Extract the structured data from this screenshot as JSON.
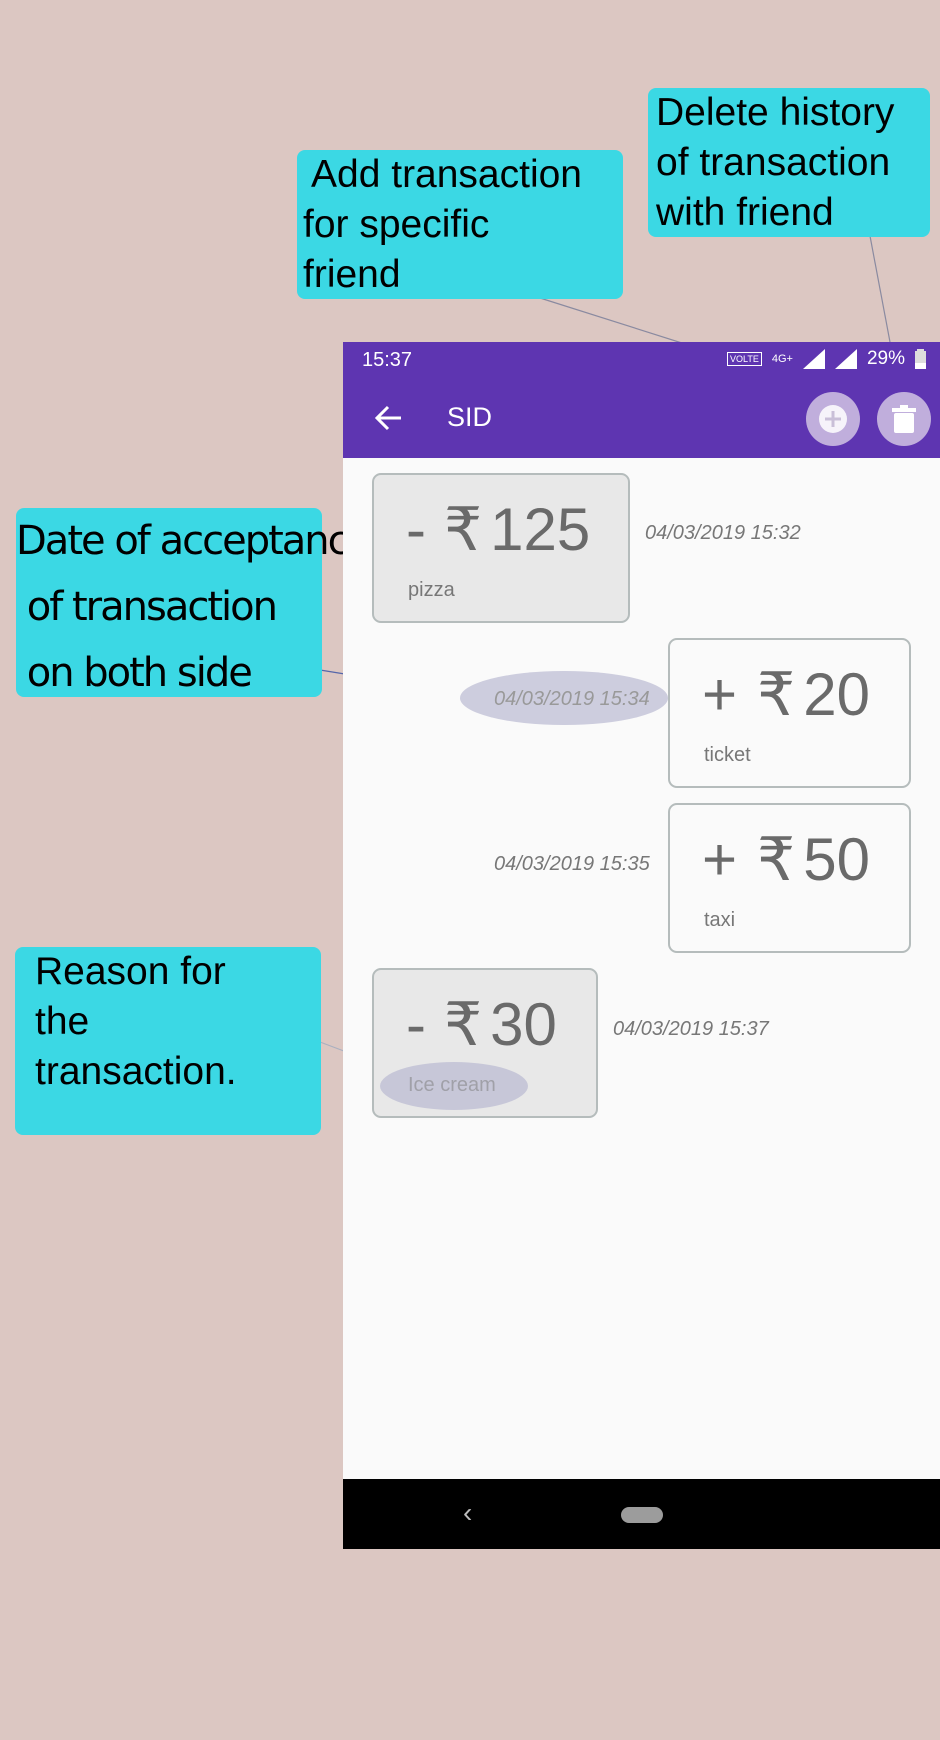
{
  "annotations": {
    "add": [
      "Add transaction",
      "for specific",
      "friend"
    ],
    "delete": [
      "Delete history",
      "of transaction",
      "with friend"
    ],
    "date": [
      "Date of acceptance",
      " of transaction",
      " on both side"
    ],
    "reason": [
      "Reason for",
      "the",
      "transaction."
    ]
  },
  "statusbar": {
    "time": "15:37",
    "volte": "VOLTE",
    "network": "4G+",
    "battery": "29%"
  },
  "appbar": {
    "title": "SID"
  },
  "transactions": [
    {
      "sign": "-",
      "currency": "₹",
      "amount": "125",
      "reason": "pizza",
      "timestamp": "04/03/2019 15:32"
    },
    {
      "sign": "+",
      "currency": "₹",
      "amount": "20",
      "reason": "ticket",
      "timestamp": "04/03/2019 15:34"
    },
    {
      "sign": "+",
      "currency": "₹",
      "amount": "50",
      "reason": "taxi",
      "timestamp": "04/03/2019 15:35"
    },
    {
      "sign": "-",
      "currency": "₹",
      "amount": "30",
      "reason": "Ice cream",
      "timestamp": "04/03/2019 15:37"
    }
  ],
  "navbar": {
    "back_glyph": "‹"
  },
  "colors": {
    "primary": "#5e35b1",
    "callout": "#3bd8e4",
    "background": "#dcc7c2",
    "nav": "#000000"
  },
  "icons": {
    "back": "arrow-left-icon",
    "add": "plus-circle-icon",
    "delete": "trash-icon"
  }
}
